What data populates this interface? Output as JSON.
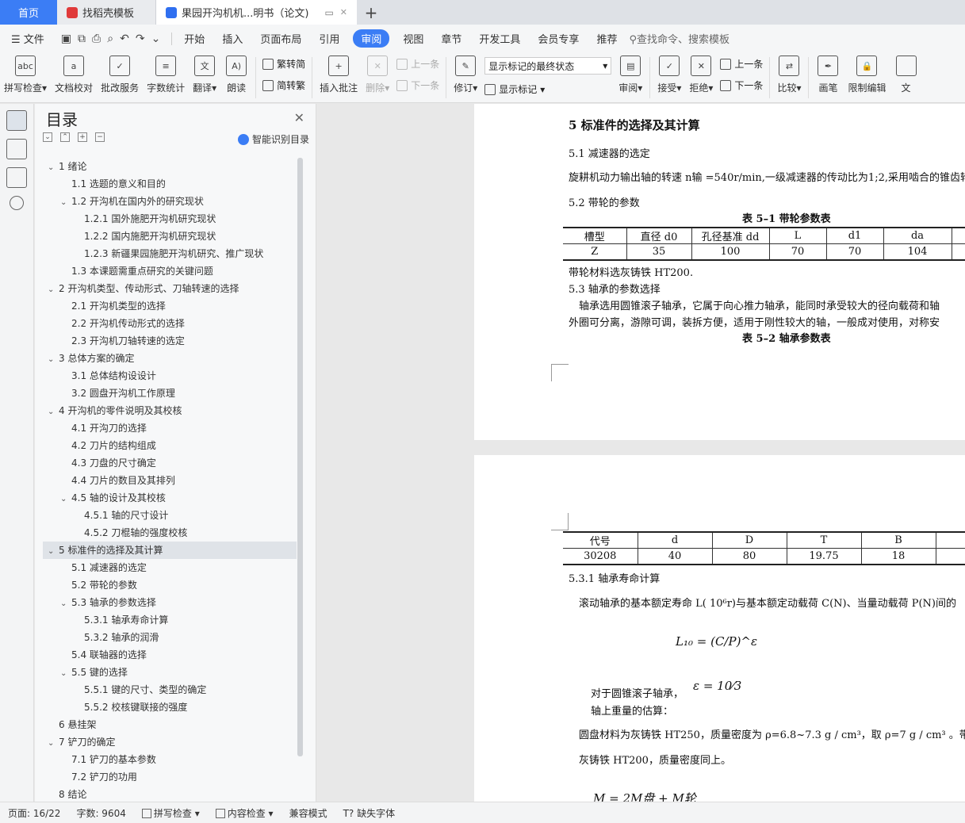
{
  "tabs": {
    "home": "首页",
    "template": "找稻壳模板",
    "doc": "果园开沟机机...明书（论文)"
  },
  "menu": {
    "file": "文件",
    "items": [
      "开始",
      "插入",
      "页面布局",
      "引用",
      "审阅",
      "视图",
      "章节",
      "开发工具",
      "会员专享",
      "推荐"
    ],
    "active": "审阅",
    "search": "查找命令、搜索模板"
  },
  "ribbon": {
    "spell": "拼写检查",
    "proof": "文档校对",
    "batch": "批改服务",
    "count": "字数统计",
    "translate": "翻译",
    "read": "朗读",
    "trad": "繁转简",
    "simp": "简转繁",
    "insert_comment": "插入批注",
    "delete": "删除",
    "prev": "上一条",
    "next": "下一条",
    "revise": "修订",
    "markup_dropdown": "显示标记的最终状态",
    "show_markup": "显示标记",
    "review": "审阅",
    "accept": "接受",
    "reject": "拒绝",
    "prev2": "上一条",
    "next2": "下一条",
    "compare": "比较",
    "pen": "画笔",
    "restrict": "限制编辑",
    "doc_cut": "文"
  },
  "toc": {
    "title": "目录",
    "smart": "智能识别目录",
    "items": [
      {
        "t": "1 绪论",
        "lvl": 0,
        "arr": "⌄"
      },
      {
        "t": "1.1 选题的意义和目的",
        "lvl": 1,
        "arr": ""
      },
      {
        "t": "1.2 开沟机在国内外的研究现状",
        "lvl": 1,
        "arr": "⌄"
      },
      {
        "t": "1.2.1 国外施肥开沟机研究现状",
        "lvl": 2,
        "arr": ""
      },
      {
        "t": "1.2.2 国内施肥开沟机研究现状",
        "lvl": 2,
        "arr": ""
      },
      {
        "t": "1.2.3 新疆果园施肥开沟机研究、推广现状",
        "lvl": 2,
        "arr": ""
      },
      {
        "t": "1.3 本课题需重点研究的关键问题",
        "lvl": 1,
        "arr": ""
      },
      {
        "t": "2 开沟机类型、传动形式、刀轴转速的选择",
        "lvl": 0,
        "arr": "⌄"
      },
      {
        "t": "2.1 开沟机类型的选择",
        "lvl": 1,
        "arr": ""
      },
      {
        "t": "2.2 开沟机传动形式的选择",
        "lvl": 1,
        "arr": ""
      },
      {
        "t": "2.3 开沟机刀轴转速的选定",
        "lvl": 1,
        "arr": ""
      },
      {
        "t": "3 总体方案的确定",
        "lvl": 0,
        "arr": "⌄"
      },
      {
        "t": "3.1 总体结构设设计",
        "lvl": 1,
        "arr": ""
      },
      {
        "t": "3.2 圆盘开沟机工作原理",
        "lvl": 1,
        "arr": ""
      },
      {
        "t": "4 开沟机的零件说明及其校核",
        "lvl": 0,
        "arr": "⌄"
      },
      {
        "t": "4.1 开沟刀的选择",
        "lvl": 1,
        "arr": ""
      },
      {
        "t": "4.2 刀片的结构组成",
        "lvl": 1,
        "arr": ""
      },
      {
        "t": "4.3 刀盘的尺寸确定",
        "lvl": 1,
        "arr": ""
      },
      {
        "t": "4.4 刀片的数目及其排列",
        "lvl": 1,
        "arr": ""
      },
      {
        "t": "4.5 轴的设计及其校核",
        "lvl": 1,
        "arr": "⌄"
      },
      {
        "t": "4.5.1 轴的尺寸设计",
        "lvl": 2,
        "arr": ""
      },
      {
        "t": "4.5.2 刀棍轴的强度校核",
        "lvl": 2,
        "arr": ""
      },
      {
        "t": "5 标准件的选择及其计算",
        "lvl": 0,
        "arr": "⌄",
        "sel": true
      },
      {
        "t": "5.1 减速器的选定",
        "lvl": 1,
        "arr": ""
      },
      {
        "t": "5.2 带轮的参数",
        "lvl": 1,
        "arr": ""
      },
      {
        "t": "5.3 轴承的参数选择",
        "lvl": 1,
        "arr": "⌄"
      },
      {
        "t": "5.3.1  轴承寿命计算",
        "lvl": 2,
        "arr": ""
      },
      {
        "t": "5.3.2 轴承的润滑",
        "lvl": 2,
        "arr": ""
      },
      {
        "t": "5.4 联轴器的选择",
        "lvl": 1,
        "arr": ""
      },
      {
        "t": "5.5 键的选择",
        "lvl": 1,
        "arr": "⌄"
      },
      {
        "t": "5.5.1 键的尺寸、类型的确定",
        "lvl": 2,
        "arr": ""
      },
      {
        "t": "5.5.2  校核键联接的强度",
        "lvl": 2,
        "arr": ""
      },
      {
        "t": "6 悬挂架",
        "lvl": 0,
        "arr": ""
      },
      {
        "t": "7 铲刀的确定",
        "lvl": 0,
        "arr": "⌄"
      },
      {
        "t": "7.1 铲刀的基本参数",
        "lvl": 1,
        "arr": ""
      },
      {
        "t": "7.2 铲刀的功用",
        "lvl": 1,
        "arr": ""
      },
      {
        "t": "8 结论",
        "lvl": 0,
        "arr": ""
      }
    ]
  },
  "page1": {
    "h5": "5 标准件的选择及其计算",
    "h51": "5.1 减速器的选定",
    "p51": "旋耕机动力输出轴的转速 n输 =540r/min,一级减速器的传动比为1;2,采用啮合的锥齿轮",
    "h52": "5.2 带轮的参数",
    "t1cap": "表 5–1  带轮参数表",
    "t1head": [
      "槽型",
      "直径 d0",
      "孔径基准 dd",
      "L",
      "d1",
      "da"
    ],
    "t1row": [
      "Z",
      "35",
      "100",
      "70",
      "70",
      "104"
    ],
    "mat": "带轮材料选灰铸铁 HT200.",
    "h53": "5.3 轴承的参数选择",
    "p53a": "轴承选用圆锥滚子轴承，它属于向心推力轴承，能同时承受较大的径向载荷和轴",
    "p53b": "外圈可分离，游隙可调，装拆方便，适用于刚性较大的轴，一般成对使用，对称安",
    "t2cap": "表 5–2  轴承参数表"
  },
  "page2": {
    "t2head": [
      "代号",
      "d",
      "D",
      "T",
      "B"
    ],
    "t2row": [
      "30208",
      "40",
      "80",
      "19.75",
      "18"
    ],
    "h531": "5.3.1  轴承寿命计算",
    "p1": "滚动轴承的基本额定寿命 L( 10⁶r)与基本额定动载荷 C(N)、当量动载荷 P(N)间的",
    "f1": "L₁₀ = (C/P)^ε",
    "p2": "对于圆锥滚子轴承，",
    "f2": "ε = 10⁄3",
    "p3": "轴上重量的估算：",
    "p4": "圆盘材料为灰铸铁 HT250，质量密度为 ρ=6.8~7.3 g / cm³，取 ρ=7 g / cm³ 。带轮",
    "p5": "灰铸铁 HT200，质量密度同上。",
    "f3": "M = 2M盘 + M轮"
  },
  "status": {
    "page": "页面: 16/22",
    "words": "字数: 9604",
    "spell": "拼写检查",
    "content": "内容检查",
    "compat": "兼容模式",
    "font": "缺失字体"
  }
}
